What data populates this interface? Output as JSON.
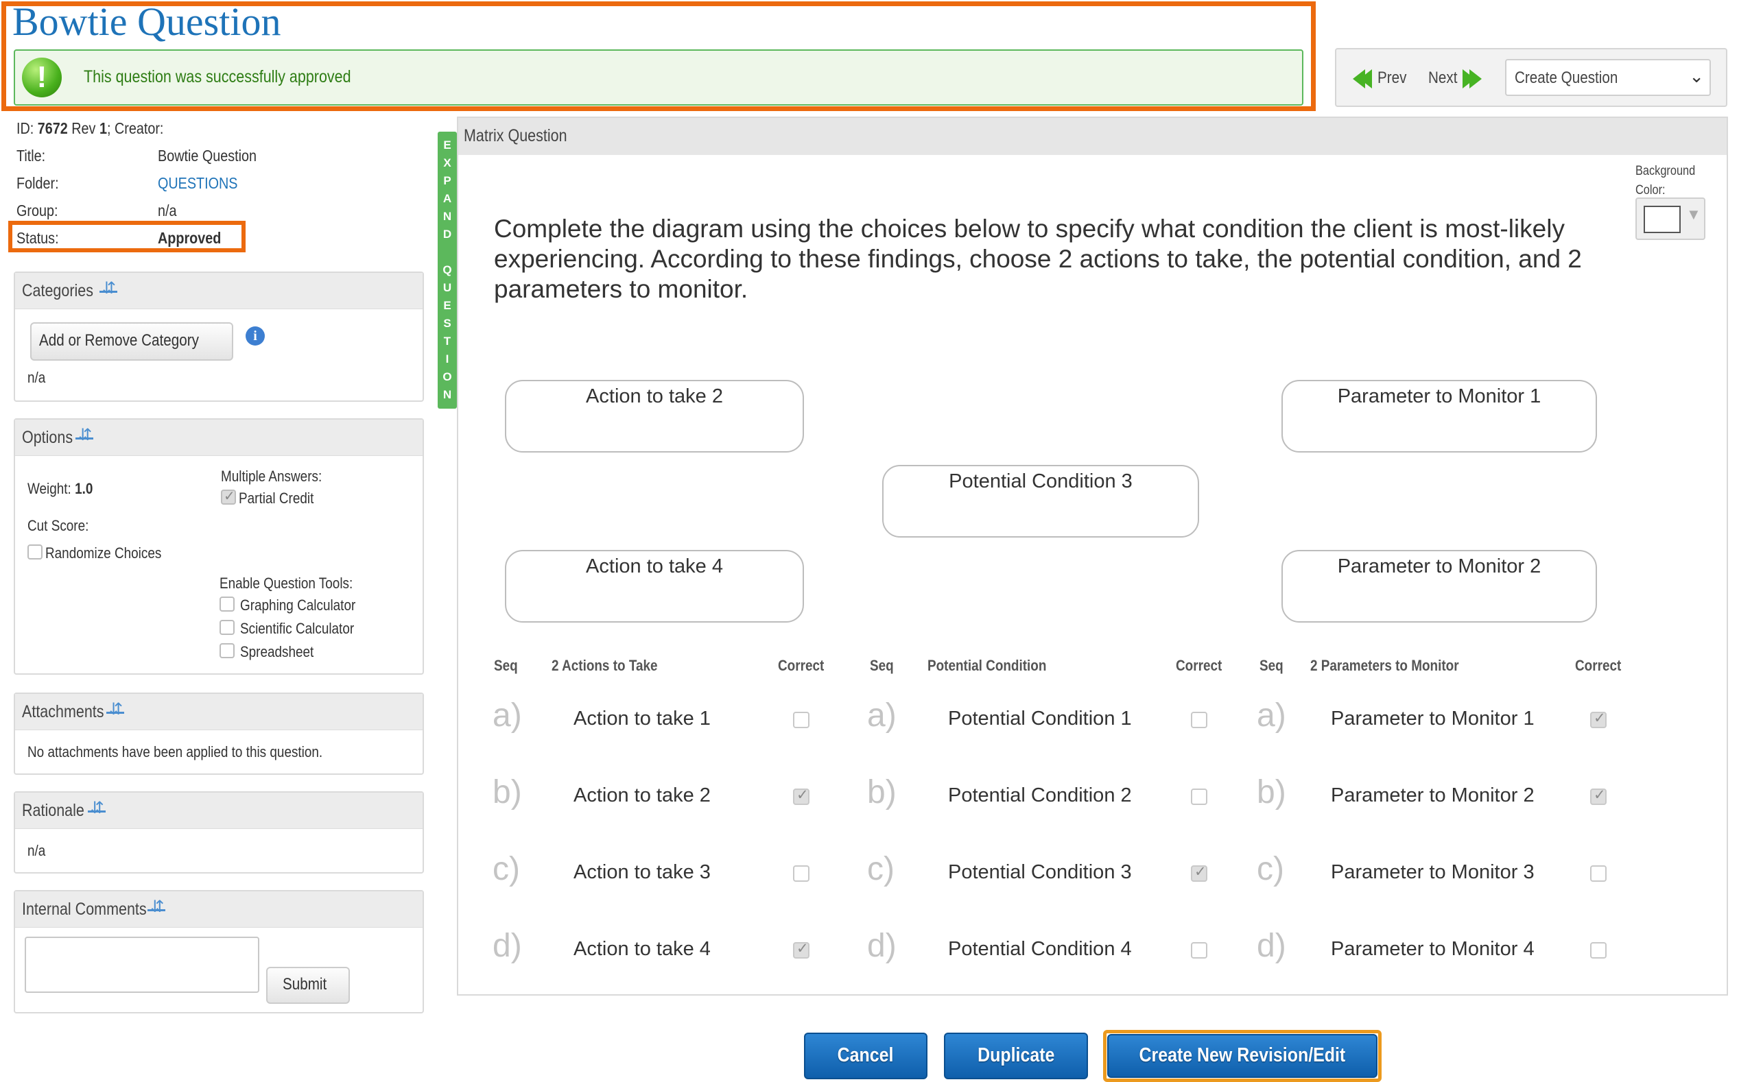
{
  "header": {
    "title": "Bowtie Question",
    "success_message": "This question was successfully approved",
    "success_icon": "exclamation-icon"
  },
  "nav": {
    "prev_label": "Prev",
    "next_label": "Next",
    "select_value": "Create Question"
  },
  "meta": {
    "id_label": "ID:",
    "id_value": "7672",
    "rev_label": "Rev",
    "rev_value": "1",
    "creator_label": "; Creator:",
    "title_label": "Title:",
    "title_value": "Bowtie Question",
    "folder_label": "Folder:",
    "folder_value": "QUESTIONS",
    "group_label": "Group:",
    "group_value": "n/a",
    "status_label": "Status:",
    "status_value": "Approved"
  },
  "categories": {
    "heading": "Categories",
    "button": "Add or Remove Category",
    "value": "n/a"
  },
  "options": {
    "heading": "Options",
    "weight_label": "Weight:",
    "weight_value": "1.0",
    "multiple_answers_label": "Multiple Answers:",
    "partial_credit_label": "Partial Credit",
    "partial_credit_checked": true,
    "cut_score_label": "Cut Score:",
    "randomize_label": "Randomize Choices",
    "randomize_checked": false,
    "tools_label": "Enable Question Tools:",
    "tools": [
      {
        "label": "Graphing Calculator",
        "checked": false
      },
      {
        "label": "Scientific Calculator",
        "checked": false
      },
      {
        "label": "Spreadsheet",
        "checked": false
      }
    ]
  },
  "attachments": {
    "heading": "Attachments",
    "text": "No attachments have been applied to this question."
  },
  "rationale": {
    "heading": "Rationale",
    "value": "n/a"
  },
  "comments": {
    "heading": "Internal Comments",
    "submit": "Submit"
  },
  "expand_strip": {
    "letters": [
      "E",
      "X",
      "P",
      "A",
      "N",
      "D",
      "",
      "Q",
      "U",
      "E",
      "S",
      "T",
      "I",
      "O",
      "N"
    ]
  },
  "question": {
    "panel_title": "Matrix Question",
    "background_color_label_1": "Background",
    "background_color_label_2": "Color:",
    "text": "Complete the diagram using the choices below to specify what condition the client is most-likely experiencing. According to these findings, choose 2 actions to take, the potential condition, and 2 parameters to monitor.",
    "diagram": {
      "action_top": "Action to take 2",
      "action_bottom": "Action to take 4",
      "condition": "Potential Condition 3",
      "param_top": "Parameter to Monitor 1",
      "param_bottom": "Parameter to Monitor 2"
    },
    "columns": {
      "seq": "Seq",
      "actions": "2 Actions to Take",
      "correct": "Correct",
      "condition": "Potential Condition",
      "parameters": "2 Parameters to Monitor"
    },
    "rows": [
      {
        "seq": "a)",
        "action": "Action to take 1",
        "action_correct": false,
        "condition": "Potential Condition 1",
        "condition_correct": false,
        "param": "Parameter to Monitor 1",
        "param_correct": true
      },
      {
        "seq": "b)",
        "action": "Action to take 2",
        "action_correct": true,
        "condition": "Potential Condition 2",
        "condition_correct": false,
        "param": "Parameter to Monitor 2",
        "param_correct": true
      },
      {
        "seq": "c)",
        "action": "Action to take 3",
        "action_correct": false,
        "condition": "Potential Condition 3",
        "condition_correct": true,
        "param": "Parameter to Monitor 3",
        "param_correct": false
      },
      {
        "seq": "d)",
        "action": "Action to take 4",
        "action_correct": true,
        "condition": "Potential Condition 4",
        "condition_correct": false,
        "param": "Parameter to Monitor 4",
        "param_correct": false
      }
    ]
  },
  "actions": {
    "cancel": "Cancel",
    "duplicate": "Duplicate",
    "revision": "Create New Revision/Edit"
  },
  "colors": {
    "accent_blue": "#1e73b8",
    "highlight_orange": "#ec6a0e",
    "success_green": "#5cb85c",
    "button_blue": "#1a6fbf"
  }
}
